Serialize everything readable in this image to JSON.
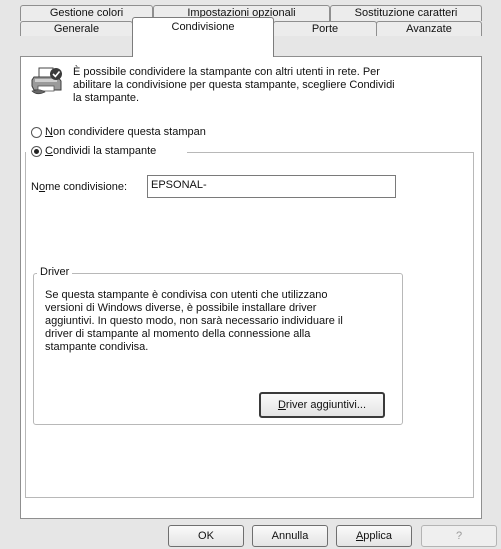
{
  "tabs_row1": [
    "Gestione colori",
    "Impostazioni opzionali",
    "Sostituzione caratteri"
  ],
  "tabs_row2": [
    "Generale",
    "Condivisione",
    "Porte",
    "Avanzate"
  ],
  "active_tab": "Condivisione",
  "info": {
    "line1": "È possibile condividere la stampante con altri utenti in rete. Per",
    "line2": "abilitare la condivisione per questa stampante, scegliere Condividi",
    "line3": "la stampante."
  },
  "sharing": {
    "not_share": {
      "mnemonic": "N",
      "rest": "on condividere questa stampan"
    },
    "share": {
      "mnemonic": "C",
      "rest": "ondividi la stampante"
    },
    "selected": "share"
  },
  "share_name": {
    "label_pre": "N",
    "label_mnemonic": "o",
    "label_post": "me condivisione:",
    "value": "EPSONAL-"
  },
  "driver_group": {
    "legend": "Driver",
    "text": [
      "Se questa stampante è condivisa con utenti che utilizzano",
      "versioni di Windows diverse, è possibile installare driver",
      "aggiuntivi. In questo modo, non sarà necessario individuare il",
      "driver di stampante al momento della connessione alla",
      "stampante condivisa."
    ],
    "button": {
      "mnemonic": "D",
      "rest": "river aggiuntivi..."
    }
  },
  "footer": {
    "ok": "OK",
    "cancel": "Annulla",
    "apply": {
      "mnemonic": "A",
      "rest": "pplica"
    },
    "help": "?"
  }
}
